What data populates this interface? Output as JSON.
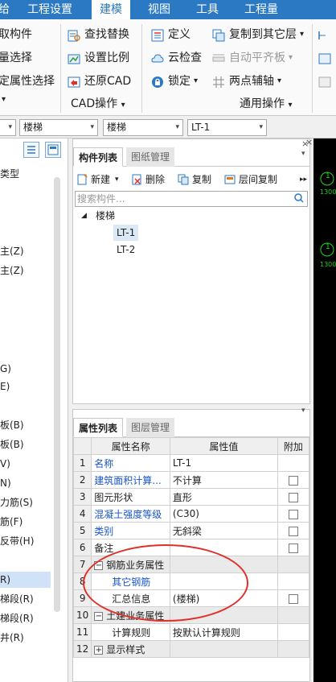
{
  "menu": {
    "items": [
      "给",
      "工程设置",
      "建模",
      "视图",
      "工具",
      "工程量"
    ],
    "active": "建模"
  },
  "ribbon": {
    "col1": [
      "取构件",
      "量选择",
      "定属性选择"
    ],
    "col2": [
      "查找替换",
      "设置比例",
      "还原CAD"
    ],
    "col3": [
      "定义",
      "云检查",
      "锁定"
    ],
    "col3_dropdown": [
      "",
      "",
      "▾"
    ],
    "col4": [
      "复制到其它层",
      "自动平齐板",
      "两点辅轴"
    ],
    "col4_dropdown": [
      "▾",
      "▾",
      "▾"
    ],
    "col5": [
      "长",
      "图",
      "图"
    ],
    "group_labels": {
      "left_partial": "▾",
      "cad": "CAD操作",
      "cad_arrow": "▾",
      "general": "通用操作",
      "general_arrow": "▾"
    }
  },
  "selectors": {
    "floor": "楼梯",
    "type": "楼梯",
    "component": "LT-1",
    "arrow": "▾"
  },
  "left_panel": {
    "items": [
      {
        "text": "类型",
        "selected": false
      },
      {
        "text": "主(Z)",
        "selected": false
      },
      {
        "text": "主(Z)",
        "selected": false
      },
      {
        "text": "G)",
        "selected": false
      },
      {
        "text": "E)",
        "selected": false
      },
      {
        "text": "板(B)",
        "selected": false
      },
      {
        "text": "板(B)",
        "selected": false
      },
      {
        "text": "V)",
        "selected": false
      },
      {
        "text": "N)",
        "selected": false
      },
      {
        "text": "力筋(S)",
        "selected": false
      },
      {
        "text": "筋(F)",
        "selected": false
      },
      {
        "text": "反带(H)",
        "selected": false
      },
      {
        "text": "R)",
        "selected": true
      },
      {
        "text": "梯段(R)",
        "selected": false
      },
      {
        "text": "梯段(R)",
        "selected": false
      },
      {
        "text": "井(R)",
        "selected": false
      }
    ]
  },
  "component_list": {
    "tabs": [
      "构件列表",
      "图纸管理"
    ],
    "toolbar": [
      "新建",
      "删除",
      "复制",
      "层间复制"
    ],
    "new_arrow": "▾",
    "more": "▸▸",
    "search_placeholder": "搜索构件...",
    "tree_root": "楼梯",
    "tree_expander": "◢",
    "tree_children": [
      "LT-1",
      "LT-2"
    ],
    "close": "×",
    "pin": "▾"
  },
  "property_list": {
    "tabs": [
      "属性列表",
      "图层管理"
    ],
    "headers": [
      "",
      "属性名称",
      "属性值",
      "附加"
    ],
    "rows": [
      {
        "num": "1",
        "name": "名称",
        "value": "LT-1",
        "blue": true,
        "check": false,
        "group": false,
        "indent": false
      },
      {
        "num": "2",
        "name": "建筑面积计算...",
        "value": "不计算",
        "blue": true,
        "check": true,
        "group": false,
        "indent": false
      },
      {
        "num": "3",
        "name": "图元形状",
        "value": "直形",
        "blue": false,
        "check": true,
        "group": false,
        "indent": false
      },
      {
        "num": "4",
        "name": "混凝土强度等级",
        "value": "(C30)",
        "blue": true,
        "check": true,
        "group": false,
        "indent": false
      },
      {
        "num": "5",
        "name": "类别",
        "value": "无斜梁",
        "blue": true,
        "check": true,
        "group": false,
        "indent": false
      },
      {
        "num": "6",
        "name": "备注",
        "value": "",
        "blue": false,
        "check": true,
        "group": false,
        "indent": false
      },
      {
        "num": "7",
        "name": "钢筋业务属性",
        "value": "",
        "blue": false,
        "check": false,
        "group": true,
        "expander": "−",
        "indent": false
      },
      {
        "num": "8",
        "name": "其它钢筋",
        "value": "",
        "blue": true,
        "check": false,
        "group": false,
        "indent": true
      },
      {
        "num": "9",
        "name": "汇总信息",
        "value": "(楼梯)",
        "blue": false,
        "check": true,
        "group": false,
        "indent": true
      },
      {
        "num": "10",
        "name": "土建业务属性",
        "value": "",
        "blue": false,
        "check": false,
        "group": true,
        "expander": "−",
        "indent": false
      },
      {
        "num": "11",
        "name": "计算规则",
        "value": "按默认计算规则",
        "blue": false,
        "check": false,
        "group": false,
        "indent": true
      },
      {
        "num": "12",
        "name": "显示样式",
        "value": "",
        "blue": false,
        "check": false,
        "group": true,
        "expander": "+",
        "indent": false
      }
    ],
    "close": "×",
    "pin": "▾"
  },
  "drawing": {
    "label1": "1",
    "dim1": "1300",
    "label2": "1",
    "dim2": "1300",
    "close": "×"
  },
  "colors": {
    "menu_bg": "#2b79c2",
    "accent_blue": "#1a55c8",
    "annotation_red": "#e0302a",
    "cad_green": "#1fd31f"
  }
}
